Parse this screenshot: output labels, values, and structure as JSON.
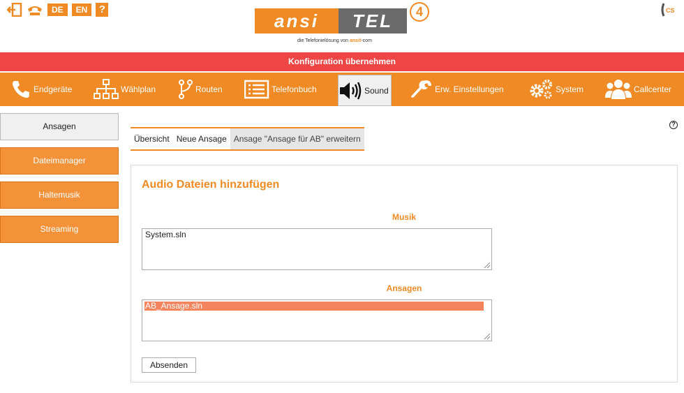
{
  "header": {
    "languages": [
      "DE",
      "EN"
    ],
    "help_symbol": "?",
    "logo": {
      "left": "ansi",
      "right": "TEL",
      "badge": "4",
      "tagline_prefix": "die Telefonielösung von",
      "tagline_brand": "ansit",
      "tagline_suffix": "-com"
    },
    "cs_label": "CS"
  },
  "config_bar": {
    "label": "Konfiguration übernehmen"
  },
  "main_nav": {
    "items": [
      {
        "label": "Endgeräte",
        "icon": "phone-icon",
        "active": false
      },
      {
        "label": "Wählplan",
        "icon": "sitemap-icon",
        "active": false
      },
      {
        "label": "Routen",
        "icon": "routes-icon",
        "active": false
      },
      {
        "label": "Telefonbuch",
        "icon": "phonebook-icon",
        "active": false
      },
      {
        "label": "Sound",
        "icon": "speaker-icon",
        "active": true
      },
      {
        "label": "Erw. Einstellungen",
        "icon": "wrench-icon",
        "active": false
      },
      {
        "label": "System",
        "icon": "gears-icon",
        "active": false
      },
      {
        "label": "Callcenter",
        "icon": "users-icon",
        "active": false
      }
    ]
  },
  "sidebar": {
    "items": [
      {
        "label": "Ansagen",
        "active": true
      },
      {
        "label": "Dateimanager",
        "active": false
      },
      {
        "label": "Haltemusik",
        "active": false
      },
      {
        "label": "Streaming",
        "active": false
      }
    ]
  },
  "help_icon": "?",
  "subtabs": [
    {
      "label": "Übersicht",
      "active": false
    },
    {
      "label": "Neue Ansage",
      "active": false
    },
    {
      "label": "Ansage \"Ansage für AB\" erweitern",
      "active": true
    }
  ],
  "panel": {
    "title": "Audio Dateien hinzufügen",
    "musik_label": "Musik",
    "musik_options": [
      "System.sln"
    ],
    "ansagen_label": "Ansagen",
    "ansagen_options": [
      "AB_Ansage.sln"
    ],
    "ansagen_selected": "AB_Ansage.sln",
    "submit_label": "Absenden"
  },
  "colors": {
    "accent": "#f08a24",
    "alert": "#f04545",
    "selected": "#f4845e"
  }
}
